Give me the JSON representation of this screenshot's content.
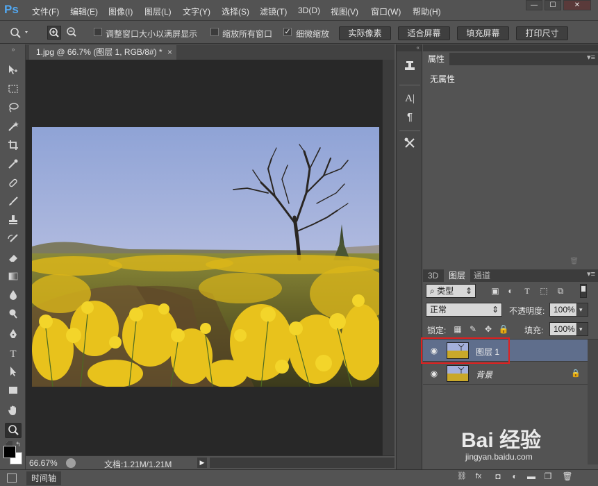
{
  "app": {
    "logo": "Ps",
    "menu": [
      "文件(F)",
      "编辑(E)",
      "图像(I)",
      "图层(L)",
      "文字(Y)",
      "选择(S)",
      "滤镜(T)",
      "3D(D)",
      "视图(V)",
      "窗口(W)",
      "帮助(H)"
    ],
    "window_controls": [
      "—",
      "☐",
      "✕"
    ]
  },
  "options_bar": {
    "tool_icon": "zoom-icon",
    "checkbox_resize": {
      "label": "调整窗口大小以满屏显示",
      "checked": false
    },
    "checkbox_zoom_all": {
      "label": "缩放所有窗口",
      "checked": false
    },
    "checkbox_scrubby": {
      "label": "细微缩放",
      "checked": true
    },
    "buttons": [
      "实际像素",
      "适合屏幕",
      "填充屏幕",
      "打印尺寸"
    ]
  },
  "document": {
    "tab_title": "1.jpg @ 66.7% (图层 1, RGB/8#) *",
    "tab_close": "×",
    "zoom_readout": "66.67%",
    "doc_info": "文档:1.21M/1.21M"
  },
  "timeline": {
    "tab": "时间轴"
  },
  "properties_panel": {
    "tab": "属性",
    "empty_text": "无属性"
  },
  "layers_panel": {
    "tabs": [
      "3D",
      "图层",
      "通道"
    ],
    "filter_kind": "类型",
    "blend_mode": "正常",
    "opacity_label": "不透明度:",
    "opacity_value": "100%",
    "lock_label": "锁定:",
    "fill_label": "填充:",
    "fill_value": "100%",
    "layers": [
      {
        "name": "图层 1",
        "selected": true,
        "locked": false
      },
      {
        "name": "背景",
        "selected": false,
        "locked": true
      }
    ]
  },
  "watermark": {
    "brand": "Bai 经验",
    "url": "jingyan.baidu.com"
  },
  "colors": {
    "selection": "#5f6e8c",
    "highlight": "#e02020",
    "ps_blue": "#52a8f2"
  }
}
